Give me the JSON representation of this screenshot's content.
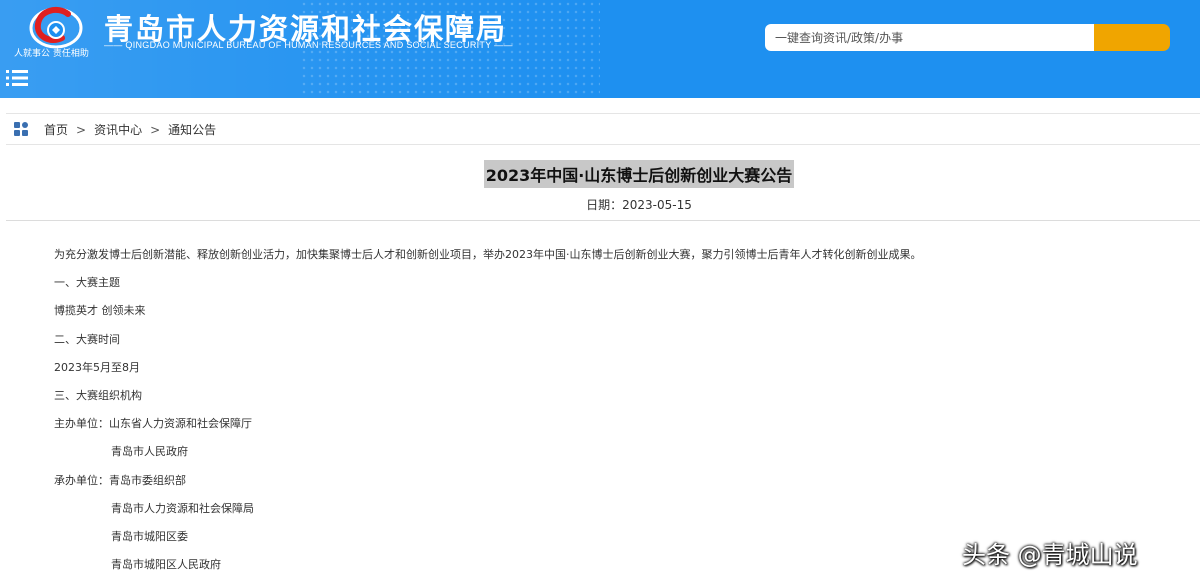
{
  "header": {
    "logo_slogan": "人就事公 责任相助",
    "site_title": "青岛市人力资源和社会保障局",
    "site_subtitle": "—— QINGDAO MUNICIPAL BUREAU OF HUMAN RESOURCES AND SOCIAL SECURITY ——",
    "search": {
      "placeholder": "一键查询资讯/政策/办事",
      "value": ""
    }
  },
  "breadcrumb": {
    "items": [
      "首页",
      "资讯中心",
      "通知公告"
    ],
    "separator": ">"
  },
  "article": {
    "title": "2023年中国·山东博士后创新创业大赛公告",
    "date": "日期：2023-05-15",
    "paragraphs": [
      "为充分激发博士后创新潜能、释放创新创业活力，加快集聚博士后人才和创新创业项目，举办2023年中国·山东博士后创新创业大赛，聚力引领博士后青年人才转化创新创业成果。",
      "一、大赛主题",
      "博揽英才  创领未来",
      "二、大赛时间",
      "2023年5月至8月",
      "三、大赛组织机构",
      "主办单位：山东省人力资源和社会保障厅",
      "青岛市人民政府",
      "承办单位：青岛市委组织部",
      "青岛市人力资源和社会保障局",
      "青岛市城阳区委",
      "青岛市城阳区人民政府"
    ]
  },
  "watermark": "头条 @青城山说",
  "colors": {
    "header_bg": "#1e90f0",
    "search_button": "#f0a500",
    "title_highlight": "#c8c8c8"
  },
  "icons": {
    "logo": "bureau-logo",
    "menu": "hamburger-menu-icon",
    "breadcrumb": "grid-icon"
  }
}
